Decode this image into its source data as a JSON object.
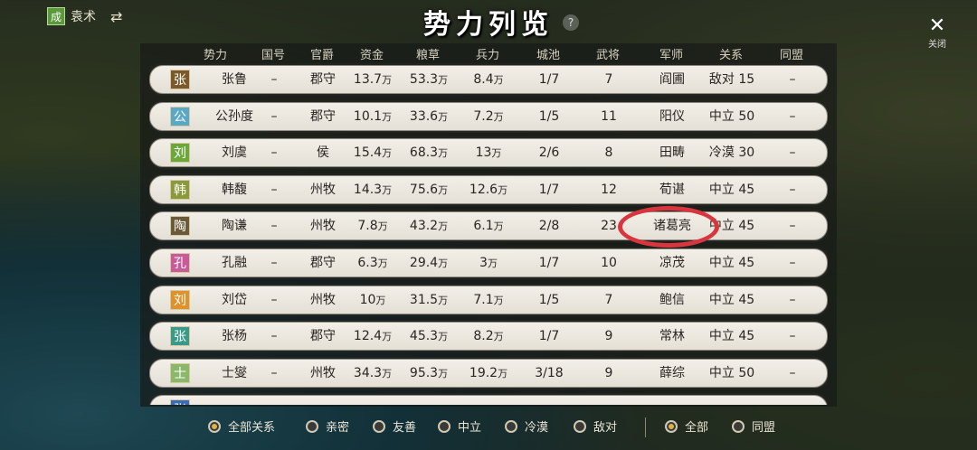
{
  "top_bar": {
    "faction_badge": "成",
    "faction_name": "袁术",
    "swap_icon": "⇄",
    "title": "势力列览",
    "help_icon": "?",
    "close_icon": "✕",
    "close_label": "关闭"
  },
  "columns": [
    "势力",
    "国号",
    "官爵",
    "资金",
    "粮草",
    "兵力",
    "城池",
    "武将",
    "军师",
    "关系",
    "同盟"
  ],
  "rows": [
    {
      "tag": "张",
      "tag_color": "#7a5a2a",
      "name": "张鲁",
      "kingdom": "–",
      "rank": "郡守",
      "funds": "13.7",
      "grain": "53.3",
      "troops": "8.4",
      "cities": "1/7",
      "generals": "7",
      "advisor": "阎圃",
      "relation": "敌对 15",
      "alliance": "–"
    },
    {
      "tag": "公",
      "tag_color": "#5aa8c8",
      "name": "公孙度",
      "kingdom": "–",
      "rank": "郡守",
      "funds": "10.1",
      "grain": "33.6",
      "troops": "7.2",
      "cities": "1/5",
      "generals": "11",
      "advisor": "阳仪",
      "relation": "中立 50",
      "alliance": "–"
    },
    {
      "tag": "刘",
      "tag_color": "#6aa83a",
      "name": "刘虞",
      "kingdom": "–",
      "rank": "侯",
      "funds": "15.4",
      "grain": "68.3",
      "troops": "13",
      "cities": "2/6",
      "generals": "8",
      "advisor": "田畴",
      "relation": "冷漠 30",
      "alliance": "–"
    },
    {
      "tag": "韩",
      "tag_color": "#8a9a3a",
      "name": "韩馥",
      "kingdom": "–",
      "rank": "州牧",
      "funds": "14.3",
      "grain": "75.6",
      "troops": "12.6",
      "cities": "1/7",
      "generals": "12",
      "advisor": "荀谌",
      "relation": "中立 45",
      "alliance": "–"
    },
    {
      "tag": "陶",
      "tag_color": "#6a5a3a",
      "name": "陶谦",
      "kingdom": "–",
      "rank": "州牧",
      "funds": "7.8",
      "grain": "43.2",
      "troops": "6.1",
      "cities": "2/8",
      "generals": "23",
      "advisor": "诸葛亮",
      "relation": "中立 45",
      "alliance": "–"
    },
    {
      "tag": "孔",
      "tag_color": "#c85a9a",
      "name": "孔融",
      "kingdom": "–",
      "rank": "郡守",
      "funds": "6.3",
      "grain": "29.4",
      "troops": "3",
      "cities": "1/7",
      "generals": "10",
      "advisor": "凉茂",
      "relation": "中立 45",
      "alliance": "–"
    },
    {
      "tag": "刘",
      "tag_color": "#e0922a",
      "name": "刘岱",
      "kingdom": "–",
      "rank": "州牧",
      "funds": "10",
      "grain": "31.5",
      "troops": "7.1",
      "cities": "1/5",
      "generals": "7",
      "advisor": "鲍信",
      "relation": "中立 45",
      "alliance": "–"
    },
    {
      "tag": "张",
      "tag_color": "#3a9a8a",
      "name": "张杨",
      "kingdom": "–",
      "rank": "郡守",
      "funds": "12.4",
      "grain": "45.3",
      "troops": "8.2",
      "cities": "1/7",
      "generals": "9",
      "advisor": "常林",
      "relation": "中立 45",
      "alliance": "–"
    },
    {
      "tag": "士",
      "tag_color": "#8ab86a",
      "name": "士燮",
      "kingdom": "–",
      "rank": "州牧",
      "funds": "34.3",
      "grain": "95.3",
      "troops": "19.2",
      "cities": "3/18",
      "generals": "9",
      "advisor": "薛综",
      "relation": "中立 50",
      "alliance": "–"
    },
    {
      "tag": "张",
      "tag_color": "#3a6ab8",
      "name": "",
      "kingdom": "",
      "rank": "",
      "funds": "",
      "grain": "",
      "troops": "",
      "cities": "",
      "generals": "",
      "advisor": "",
      "relation": "",
      "alliance": ""
    }
  ],
  "unit": "万",
  "filters": {
    "relation": [
      {
        "label": "全部关系",
        "selected": true
      },
      {
        "label": "亲密",
        "selected": false
      },
      {
        "label": "友善",
        "selected": false
      },
      {
        "label": "中立",
        "selected": false
      },
      {
        "label": "冷漠",
        "selected": false
      },
      {
        "label": "敌对",
        "selected": false
      }
    ],
    "alliance": [
      {
        "label": "全部",
        "selected": true
      },
      {
        "label": "同盟",
        "selected": false
      }
    ]
  },
  "highlight_color": "#d9353f"
}
